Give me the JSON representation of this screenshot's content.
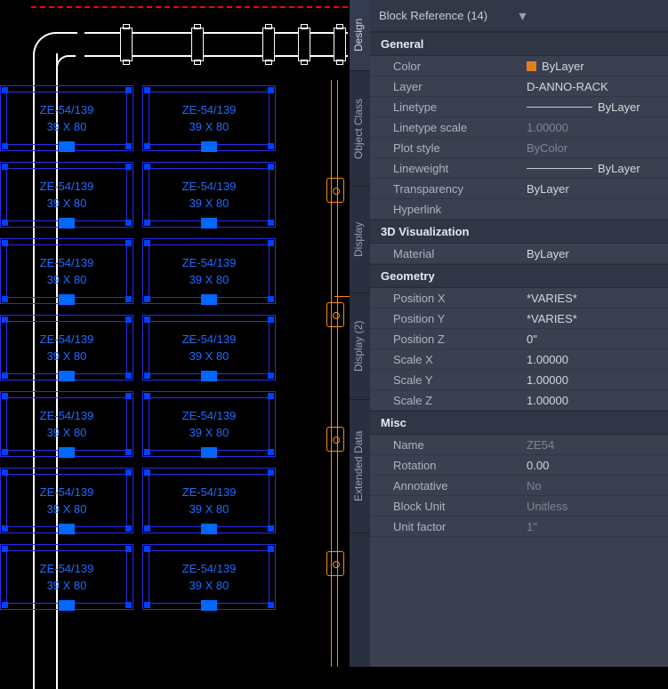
{
  "header": {
    "title": "Block Reference (14)"
  },
  "tabs": [
    "Design",
    "Object Class",
    "Display",
    "Display (2)",
    "Extended Data"
  ],
  "rack": {
    "label": "ZE-54/139",
    "dims": "39 X 80"
  },
  "sections": {
    "general": "General",
    "vis": "3D Visualization",
    "geom": "Geometry",
    "misc": "Misc"
  },
  "props": {
    "color_k": "Color",
    "color_v": "ByLayer",
    "layer_k": "Layer",
    "layer_v": "D-ANNO-RACK",
    "ltype_k": "Linetype",
    "ltype_v": "ByLayer",
    "ltscale_k": "Linetype scale",
    "ltscale_v": "1.00000",
    "pstyle_k": "Plot style",
    "pstyle_v": "ByColor",
    "lweight_k": "Lineweight",
    "lweight_v": "ByLayer",
    "trans_k": "Transparency",
    "trans_v": "ByLayer",
    "hlink_k": "Hyperlink",
    "hlink_v": "",
    "mat_k": "Material",
    "mat_v": "ByLayer",
    "px_k": "Position X",
    "px_v": "*VARIES*",
    "py_k": "Position Y",
    "py_v": "*VARIES*",
    "pz_k": "Position Z",
    "pz_v": "0\"",
    "sx_k": "Scale X",
    "sx_v": "1.00000",
    "sy_k": "Scale Y",
    "sy_v": "1.00000",
    "sz_k": "Scale Z",
    "sz_v": "1.00000",
    "name_k": "Name",
    "name_v": "ZE54",
    "rot_k": "Rotation",
    "rot_v": "0.00",
    "anno_k": "Annotative",
    "anno_v": "No",
    "bunit_k": "Block Unit",
    "bunit_v": "Unitless",
    "ufac_k": "Unit factor",
    "ufac_v": "1\""
  }
}
